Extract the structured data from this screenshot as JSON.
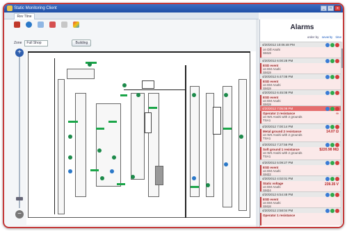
{
  "window": {
    "title": "Static Monitoring Client",
    "minimize": "_",
    "maximize": "□",
    "close": "x"
  },
  "tabs": [
    {
      "label": "Rev Tline"
    }
  ],
  "toolbar": {
    "icons": [
      "home-icon",
      "globe-icon",
      "arrow-icon",
      "printer-icon",
      "print-preview-icon",
      "palette-icon"
    ]
  },
  "zone": {
    "label": "Zone",
    "value": "Full Shop",
    "building_button": "Building"
  },
  "zoom": {
    "plus": "+",
    "minus": "−"
  },
  "alarms": {
    "title": "Alarms",
    "sort_label": "order by",
    "sort_links": [
      "severity",
      "time"
    ],
    "items": [
      {
        "stamp": "4/20/2012 10:06:48 PM",
        "highlight": false,
        "type": "",
        "location": "on Dill Anahi",
        "device": "SM19",
        "value": ""
      },
      {
        "stamp": "4/20/2012 6:00:28 PM",
        "highlight": false,
        "type": "ESD event",
        "location": "on EM Anahi",
        "device": "SM19",
        "value": ""
      },
      {
        "stamp": "4/20/2012 6:47:08 PM",
        "highlight": false,
        "type": "ESD event",
        "location": "on EM Anahi",
        "device": "SM19",
        "value": ""
      },
      {
        "stamp": "4/20/2012 6:45:08 PM",
        "highlight": false,
        "type": "ESD event",
        "location": "on EM Anahi",
        "device": "SM19",
        "value": ""
      },
      {
        "stamp": "4/20/2012 7:05:08 PM",
        "highlight": true,
        "type": "Operator 2 resistance",
        "location": "on WS Anahi with 2 grounds",
        "device": "TSA1",
        "value": "∞"
      },
      {
        "stamp": "4/20/2012 7:00:14 PM",
        "highlight": false,
        "type": "Metal ground 2 resistance",
        "location": "on WS Anahi with 2 grounds",
        "device": "TSA1",
        "value": "14.07 Ω"
      },
      {
        "stamp": "4/20/2012 7:27:56 PM",
        "highlight": false,
        "type": "Soft ground 1 resistance",
        "location": "on WS Anahi with 2 grounds",
        "device": "TSA1",
        "value": "$220.98 MΩ"
      },
      {
        "stamp": "4/20/2012 5:09:27 PM",
        "highlight": false,
        "type": "ESD event",
        "location": "on EM Anahi",
        "device": "SM22",
        "value": ""
      },
      {
        "stamp": "4/20/2012 4:02:01 PM",
        "highlight": false,
        "type": "Static voltage",
        "location": "on EM Anahi",
        "device": "SM24",
        "value": "239.35 V"
      },
      {
        "stamp": "4/20/2012 6:54:48 PM",
        "highlight": false,
        "type": "ESD event",
        "location": "on EM Anahi",
        "device": "SM18",
        "value": ""
      },
      {
        "stamp": "4/20/2012 2:58:04 PM",
        "highlight": false,
        "type": "Operator 1 resistance",
        "location": "",
        "device": "",
        "value": ""
      }
    ]
  },
  "colors": {
    "accent": "#c43a3a",
    "alarm_red": "#e56d6d",
    "ok_green": "#2fa84a",
    "title_blue": "#2a5bb5"
  }
}
